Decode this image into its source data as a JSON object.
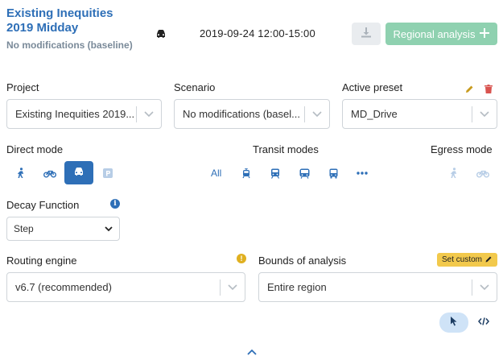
{
  "header": {
    "title": "Existing Inequities 2019 Midday",
    "subtitle": "No modifications (baseline)",
    "datetime": "2019-09-24  12:00-15:00",
    "regional_analysis_label": "Regional analysis"
  },
  "project": {
    "label": "Project",
    "value": "Existing Inequities 2019..."
  },
  "scenario": {
    "label": "Scenario",
    "value": "No modifications (basel..."
  },
  "preset": {
    "label": "Active preset",
    "value": "MD_Drive"
  },
  "modes": {
    "direct_label": "Direct mode",
    "transit_label": "Transit modes",
    "egress_label": "Egress mode",
    "transit_all": "All",
    "direct_active": "car",
    "icons": {
      "direct": [
        "walk-icon",
        "bike-icon",
        "car-icon",
        "park-icon"
      ],
      "transit": [
        "tram-icon",
        "rail-icon",
        "subway-icon",
        "bus-icon",
        "more-icon"
      ],
      "egress": [
        "walk-icon",
        "bike-icon"
      ]
    }
  },
  "decay": {
    "label": "Decay Function",
    "value": "Step"
  },
  "routing": {
    "label": "Routing engine",
    "value": "v6.7 (recommended)"
  },
  "bounds": {
    "label": "Bounds of analysis",
    "value": "Entire region",
    "set_custom_label": "Set custom"
  },
  "colors": {
    "accent": "#2e6fb7",
    "regional_btn": "#8fd1b0",
    "set_custom": "#f2c94c",
    "delete": "#d9534f",
    "edit": "#c89b1e"
  }
}
